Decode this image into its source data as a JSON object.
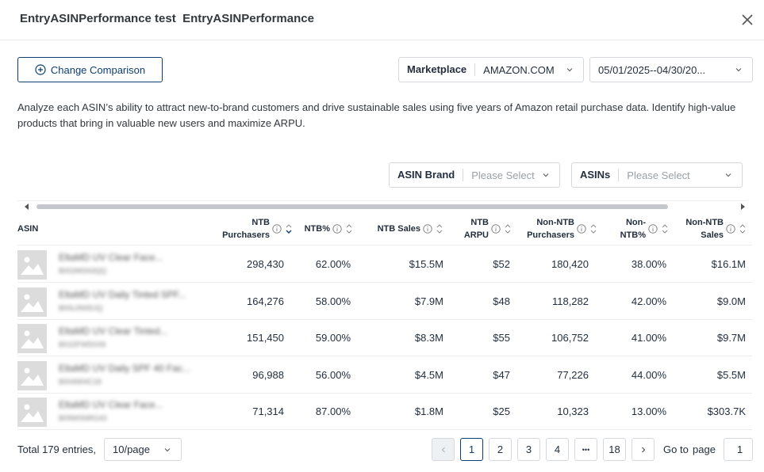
{
  "header": {
    "title": "EntryASINPerformance test  EntryASINPerformance"
  },
  "toolbar": {
    "compare_label": "Change Comparison",
    "marketplace_label": "Marketplace",
    "marketplace_value": "AMAZON.COM",
    "date_value": "05/01/2025--04/30/20..."
  },
  "description": "Analyze each ASIN’s ability to attract new-to-brand customers and drive sustainable sales using five years of Amazon retail purchase data. Identify high-value products that bring in valuable new users and maximize ARPU.",
  "filters": {
    "brand_label": "ASIN Brand",
    "brand_placeholder": "Please Select",
    "asins_label": "ASINs",
    "asins_placeholder": "Please Select"
  },
  "table": {
    "headers": {
      "asin": "ASIN",
      "ntb_purchasers_1": "NTB",
      "ntb_purchasers_2": "Purchasers",
      "ntb_pct": "NTB%",
      "ntb_sales": "NTB Sales",
      "ntb_arpu_1": "NTB",
      "ntb_arpu_2": "ARPU",
      "non_ntb_purchasers_1": "Non-NTB",
      "non_ntb_purchasers_2": "Purchasers",
      "non_ntb_pct_1": "Non-",
      "non_ntb_pct_2": "NTB%",
      "non_ntb_sales_1": "Non-NTB",
      "non_ntb_sales_2": "Sales"
    },
    "rows": [
      {
        "name": "EltaMD UV Clear Face...",
        "asin": "B002MSN3QQ",
        "ntb_purchasers": "298,430",
        "ntb_pct": "62.00%",
        "ntb_sales": "$15.5M",
        "ntb_arpu": "$52",
        "non_ntb_purchasers": "180,420",
        "non_ntb_pct": "38.00%",
        "non_ntb_sales": "$16.1M"
      },
      {
        "name": "EltaMD UV Daily Tinted SPF...",
        "asin": "B00L0N0DJQ",
        "ntb_purchasers": "164,276",
        "ntb_pct": "58.00%",
        "ntb_sales": "$7.9M",
        "ntb_arpu": "$48",
        "non_ntb_purchasers": "118,282",
        "non_ntb_pct": "42.00%",
        "non_ntb_sales": "$9.0M"
      },
      {
        "name": "EltaMD UV Clear Tinted...",
        "asin": "B01DFWD0X8",
        "ntb_purchasers": "151,450",
        "ntb_pct": "59.00%",
        "ntb_sales": "$8.3M",
        "ntb_arpu": "$55",
        "non_ntb_purchasers": "106,752",
        "non_ntb_pct": "41.00%",
        "non_ntb_sales": "$9.7M"
      },
      {
        "name": "EltaMD UV Daily SPF 40 Fac...",
        "asin": "B004WI4C18",
        "ntb_purchasers": "96,988",
        "ntb_pct": "56.00%",
        "ntb_sales": "$4.5M",
        "ntb_arpu": "$47",
        "non_ntb_purchasers": "77,226",
        "non_ntb_pct": "44.00%",
        "non_ntb_sales": "$5.5M"
      },
      {
        "name": "EltaMD UV Clear Face...",
        "asin": "B09WSNRG43",
        "ntb_purchasers": "71,314",
        "ntb_pct": "87.00%",
        "ntb_sales": "$1.8M",
        "ntb_arpu": "$25",
        "non_ntb_purchasers": "10,323",
        "non_ntb_pct": "13.00%",
        "non_ntb_sales": "$303.7K"
      }
    ]
  },
  "footer": {
    "total": "Total 179 entries,",
    "page_size": "10/page",
    "pages": [
      "1",
      "2",
      "3",
      "4",
      "•••",
      "18"
    ],
    "goto_label": "Go to",
    "page_label": "page",
    "goto_value": "1"
  },
  "colors": {
    "accent": "#0c3f6f",
    "border": "#d5d9dd"
  }
}
